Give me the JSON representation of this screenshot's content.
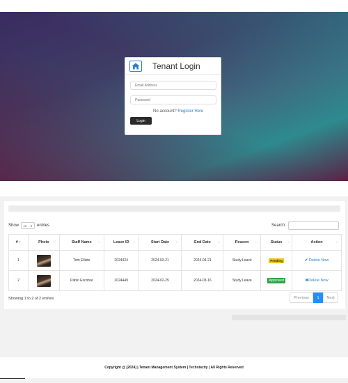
{
  "login": {
    "title": "Tenant Login",
    "email_placeholder": "Email Address",
    "password_placeholder": "Password",
    "no_account_text": "No account?",
    "register_link": "Register Here",
    "login_button": "Login",
    "home_icon": "home-icon"
  },
  "table_controls": {
    "show_label": "Show",
    "entries_value": "10",
    "entries_label": "entries",
    "search_label": "Search:"
  },
  "table": {
    "columns": [
      "#",
      "Photo",
      "Staff Name",
      "Leave ID",
      "Start Date",
      "End Date",
      "Reason",
      "Status",
      "Action"
    ],
    "rows": [
      {
        "num": "1",
        "staff": "Tom Elliste",
        "leave_id": "2024424",
        "start": "2024-03-21",
        "end": "2024-04-21",
        "reason": "Study Leave",
        "status": "Pending",
        "action": "Delete Now",
        "action_icon": "check-icon"
      },
      {
        "num": "2",
        "staff": "Pablo Escobar",
        "leave_id": "2024449",
        "start": "2024-02-25",
        "end": "2024-03-16",
        "reason": "Study Leave",
        "status": "Approved",
        "action": "Delete Now",
        "action_icon": "x-icon"
      }
    ]
  },
  "pagination": {
    "summary": "Showing 1 to 2 of 2 entries",
    "previous": "Previous",
    "current": "1",
    "next": "Next"
  },
  "footer": {
    "text": "Copyright @ [2024] | Tenant Management System | Techstacity | All Rights Reserved"
  },
  "colors": {
    "accent": "#2f7fc7",
    "pending": "#f0c419",
    "approved": "#28a745",
    "page_active": "#1f8fff"
  }
}
